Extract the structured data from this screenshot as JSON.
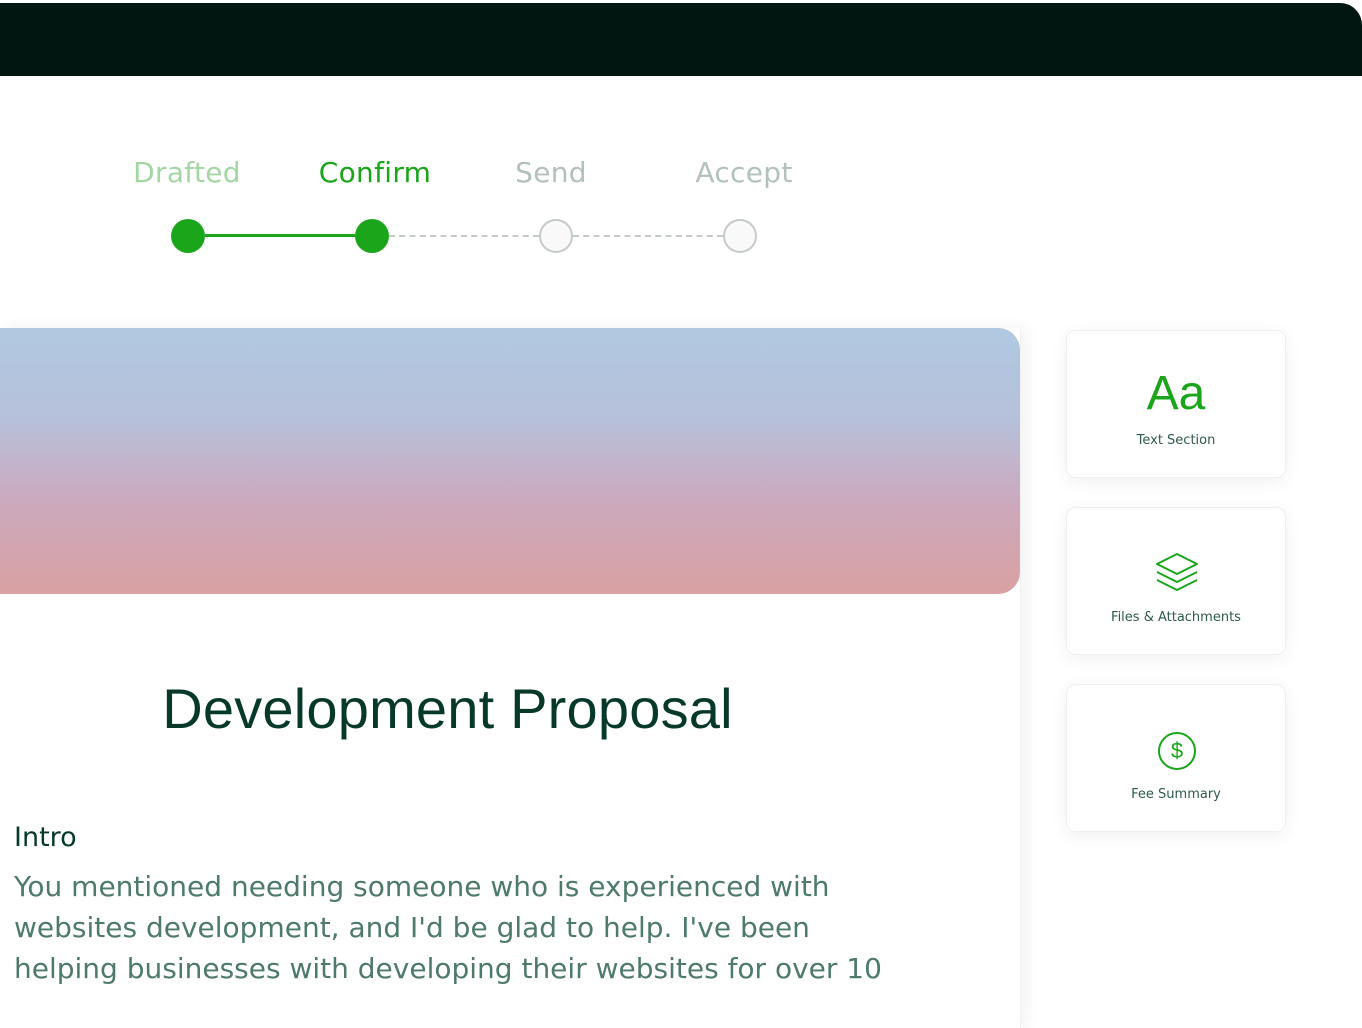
{
  "stepper": {
    "steps": [
      {
        "label": "Drafted",
        "state": "completed",
        "color": "#a3d6a3"
      },
      {
        "label": "Confirm",
        "state": "current",
        "color": "#1aa51a"
      },
      {
        "label": "Send",
        "state": "pending",
        "color": "#b3c1bb"
      },
      {
        "label": "Accept",
        "state": "pending",
        "color": "#b3c1bb"
      }
    ]
  },
  "document": {
    "title": "Development Proposal",
    "intro_heading": "Intro",
    "intro_body": "You mentioned needing someone who is experienced with websites development, and I'd be glad to help. I've been helping businesses with developing their websites for over 10"
  },
  "sidebar": {
    "cards": [
      {
        "icon": "text-aa-icon",
        "glyph": "Aa",
        "label": "Text Section"
      },
      {
        "icon": "layers-icon",
        "label": "Files & Attachments"
      },
      {
        "icon": "dollar-circle-icon",
        "label": "Fee Summary"
      }
    ]
  },
  "colors": {
    "accent": "#1aa51a",
    "topbar": "#011611",
    "title": "#07392b",
    "body_text": "#4e7a6c"
  }
}
